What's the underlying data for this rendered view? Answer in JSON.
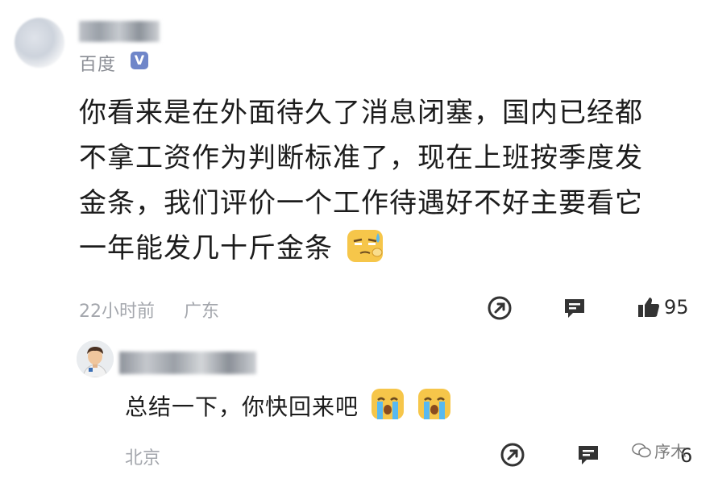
{
  "comment": {
    "source": "百度",
    "verified_mark": "V",
    "lines": [
      "你看来是在外面待久了消息闭塞，国内已经都",
      "不拿工资作为判断标准了，现在上班按季度发",
      "金条，我们评价一个工作待遇好不好主要看它",
      "一年能发几十斤金条"
    ],
    "time": "22小时前",
    "location": "广东",
    "likes": "95",
    "emoji": "sweat-face-emoji"
  },
  "reply": {
    "text": "总结一下，你快回来吧",
    "emojis": [
      "loudly-crying-face-emoji",
      "loudly-crying-face-emoji"
    ],
    "location": "北京",
    "likes": "6"
  },
  "watermark": {
    "text": "序木"
  },
  "colors": {
    "muted_text": "#a4a7ad",
    "main_text": "#1c1c1c",
    "verified_badge": "#6f86c9",
    "emoji_yellow": "#f6c64a"
  }
}
